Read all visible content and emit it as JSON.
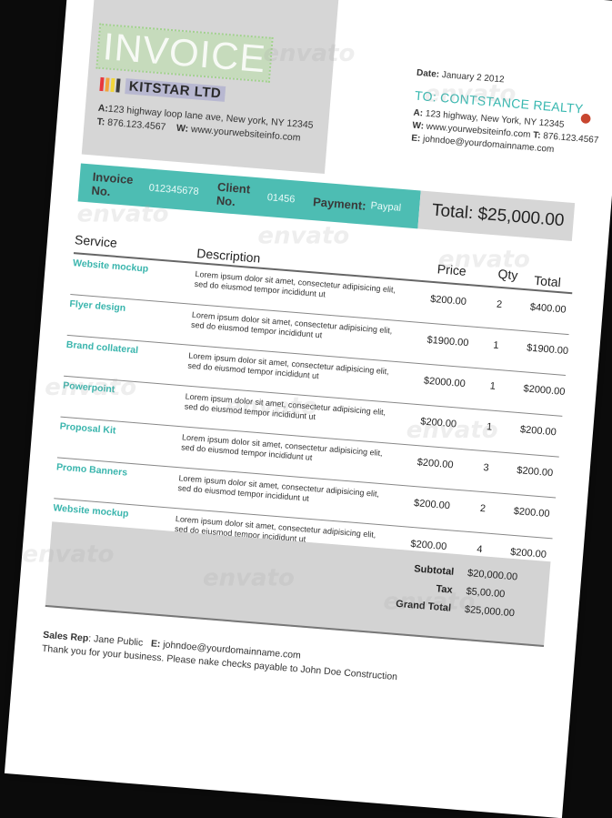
{
  "header": {
    "title": "INVOICE",
    "company": "KITSTAR LTD",
    "address_label": "A:",
    "address": "123 highway loop lane ave, New york, NY 12345",
    "phone_label": "T:",
    "phone": "876.123.4567",
    "web_label": "W:",
    "web": "www.yourwebsiteinfo.com",
    "logo_colors": [
      "#e8383d",
      "#f2a33a",
      "#f2d53a",
      "#3a3a3a"
    ]
  },
  "recipient": {
    "date_label": "Date:",
    "date": "January 2 2012",
    "to": "TO: CONTSTANCE REALTY",
    "address_label": "A:",
    "address": "123 highway, New York, NY 12345",
    "web_label": "W:",
    "web": "www.yourwebsiteinfo.com",
    "phone_label": "T:",
    "phone": "876.123.4567",
    "email_label": "E:",
    "email": "johndoe@yourdomainname.com"
  },
  "info_bar": {
    "invoice_label": "Invoice No.",
    "invoice_no": "012345678",
    "client_label": "Client No.",
    "client_no": "01456",
    "payment_label": "Payment:",
    "payment": "Paypal",
    "total": "Total: $25,000.00"
  },
  "table": {
    "headers": {
      "service": "Service",
      "description": "Description",
      "price": "Price",
      "qty": "Qty",
      "total": "Total"
    },
    "rows": [
      {
        "service": "Website mockup",
        "description": "Lorem ipsum dolor sit amet, consectetur adipisicing elit, sed do eiusmod tempor incididunt ut",
        "price": "$200.00",
        "qty": "2",
        "total": "$400.00"
      },
      {
        "service": "Flyer design",
        "description": "Lorem ipsum dolor sit amet, consectetur adipisicing elit, sed do eiusmod tempor incididunt ut",
        "price": "$1900.00",
        "qty": "1",
        "total": "$1900.00"
      },
      {
        "service": "Brand collateral",
        "description": "Lorem ipsum dolor sit amet, consectetur adipisicing elit, sed do eiusmod tempor incididunt ut",
        "price": "$2000.00",
        "qty": "1",
        "total": "$2000.00"
      },
      {
        "service": "Powerpoint",
        "description": "Lorem ipsum dolor sit amet, consectetur adipisicing elit, sed do eiusmod tempor incididunt ut",
        "price": "$200.00",
        "qty": "1",
        "total": "$200.00"
      },
      {
        "service": "Proposal Kit",
        "description": "Lorem ipsum dolor sit amet, consectetur adipisicing elit, sed do eiusmod tempor incididunt ut",
        "price": "$200.00",
        "qty": "3",
        "total": "$200.00"
      },
      {
        "service": "Promo Banners",
        "description": "Lorem ipsum dolor sit amet, consectetur adipisicing elit, sed do eiusmod tempor incididunt ut",
        "price": "$200.00",
        "qty": "2",
        "total": "$200.00"
      },
      {
        "service": "Website mockup",
        "description": "Lorem ipsum dolor sit amet, consectetur adipisicing elit, sed do eiusmod tempor incididunt ut",
        "price": "$200.00",
        "qty": "4",
        "total": "$200.00"
      }
    ]
  },
  "summary": {
    "subtotal_label": "Subtotal",
    "subtotal": "$20,000.00",
    "tax_label": "Tax",
    "tax": "$5,00.00",
    "grand_label": "Grand Total",
    "grand": "$25,000.00"
  },
  "footer": {
    "rep_label": "Sales Rep",
    "rep": ": Jane Public",
    "email_label": "E:",
    "email": "johndoe@yourdomainname.com",
    "note": "Thank you for your business. Please nake checks payable to John Doe Construction"
  },
  "watermark": "envato",
  "colors": {
    "accent": "#4dbdb3",
    "panel": "#d6d6d6",
    "background": "#0b0b0b"
  }
}
